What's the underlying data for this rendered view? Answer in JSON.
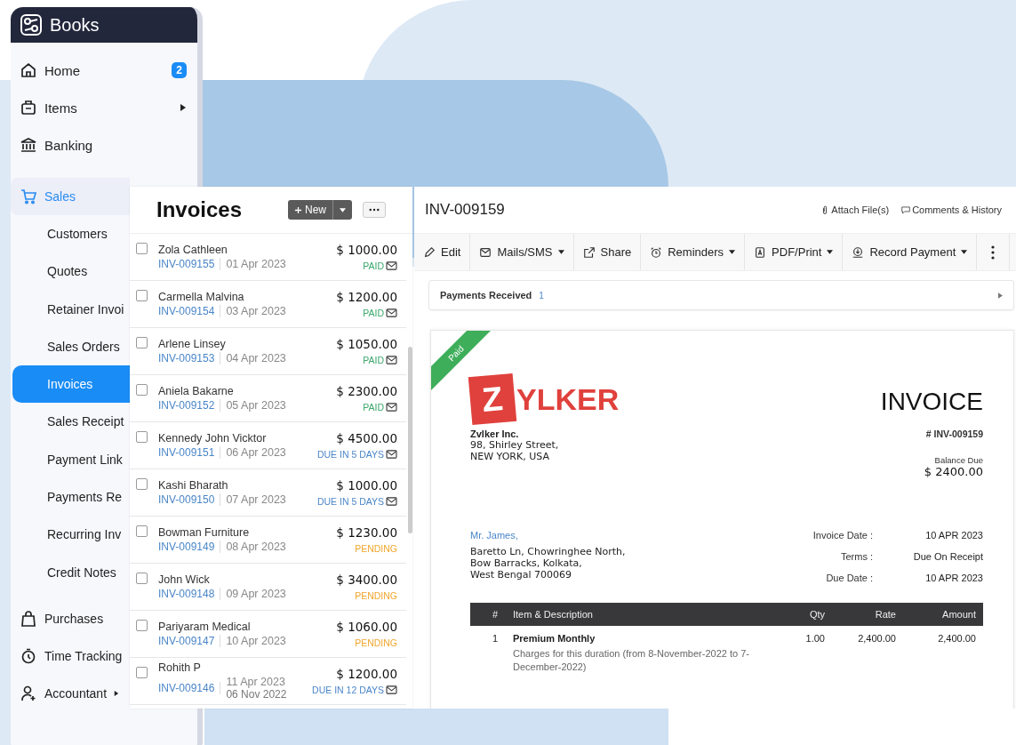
{
  "sidebar": {
    "brand": "Books",
    "items": [
      {
        "label": "Home",
        "badge": "2",
        "selected": false
      },
      {
        "label": "Items",
        "submenu": true,
        "selected": false
      },
      {
        "label": "Banking",
        "selected": false
      },
      {
        "label": "Sales",
        "selected": true,
        "children": [
          {
            "label": "Customers",
            "selected": false
          },
          {
            "label": "Quotes",
            "selected": false
          },
          {
            "label": "Retainer Invoi",
            "selected": false
          },
          {
            "label": "Sales Orders",
            "selected": false
          },
          {
            "label": "Invoices",
            "selected": true
          },
          {
            "label": "Sales Receipt",
            "selected": false
          },
          {
            "label": "Payment Link",
            "selected": false
          },
          {
            "label": "Payments Re",
            "selected": false
          },
          {
            "label": "Recurring Inv",
            "selected": false
          },
          {
            "label": "Credit Notes",
            "selected": false
          }
        ]
      },
      {
        "label": "Purchases",
        "selected": false
      },
      {
        "label": "Time Tracking",
        "selected": false
      },
      {
        "label": "Accountant",
        "submenu": true,
        "selected": false
      }
    ]
  },
  "invoice_list": {
    "title": "Invoices",
    "new_button": "New",
    "rows": [
      {
        "name": "Zola Cathleen",
        "number": "INV-009155",
        "date": "01 Apr 2023",
        "amount": "$ 1000.00",
        "status": "PAID",
        "kind": "paid",
        "emailed": true,
        "checked": false
      },
      {
        "name": "Carmella Malvina",
        "number": "INV-009154",
        "date": "03 Apr 2023",
        "amount": "$ 1200.00",
        "status": "PAID",
        "kind": "paid",
        "emailed": true,
        "checked": false
      },
      {
        "name": "Arlene Linsey",
        "number": "INV-009153",
        "date": "04 Apr 2023",
        "amount": "$ 1050.00",
        "status": "PAID",
        "kind": "paid",
        "emailed": true,
        "checked": false
      },
      {
        "name": "Aniela Bakarne",
        "number": "INV-009152",
        "date": "05 Apr 2023",
        "amount": "$ 2300.00",
        "status": "PAID",
        "kind": "paid",
        "emailed": true,
        "checked": false
      },
      {
        "name": "Kennedy John Vicktor",
        "number": "INV-009151",
        "date": "06 Apr 2023",
        "amount": "$ 4500.00",
        "status": "DUE IN 5 DAYS",
        "kind": "due",
        "emailed": true,
        "checked": false
      },
      {
        "name": "Kashi Bharath",
        "number": "INV-009150",
        "date": "07 Apr 2023",
        "amount": "$ 1000.00",
        "status": "DUE IN 5 DAYS",
        "kind": "due",
        "emailed": true,
        "checked": false
      },
      {
        "name": "Bowman Furniture",
        "number": "INV-009149",
        "date": "08 Apr 2023",
        "amount": "$ 1230.00",
        "status": "PENDING",
        "kind": "pending",
        "emailed": false,
        "checked": false
      },
      {
        "name": "John Wick",
        "number": "INV-009148",
        "date": "09 Apr 2023",
        "amount": "$ 3400.00",
        "status": "PENDING",
        "kind": "pending",
        "emailed": false,
        "checked": false
      },
      {
        "name": "Pariyaram Medical",
        "number": "INV-009147",
        "date": "10 Apr 2023",
        "amount": "$ 1060.00",
        "status": "PENDING",
        "kind": "pending",
        "emailed": false,
        "checked": false
      },
      {
        "name": "Rohith P",
        "number": "INV-009146",
        "date": "11 Apr 2023",
        "old_date": "06 Nov 2022",
        "amount": "$ 1200.00",
        "status": "DUE IN 12 DAYS",
        "kind": "due",
        "emailed": true,
        "checked": false
      }
    ]
  },
  "detail": {
    "title": "INV-009159",
    "attach": "Attach File(s)",
    "comments": "Comments & History",
    "toolbar": [
      {
        "label": "Edit",
        "dropdown": false
      },
      {
        "label": "Mails/SMS",
        "dropdown": true
      },
      {
        "label": "Share",
        "dropdown": false
      },
      {
        "label": "Reminders",
        "dropdown": true
      },
      {
        "label": "PDF/Print",
        "dropdown": true
      },
      {
        "label": "Record Payment",
        "dropdown": true
      }
    ],
    "payments": {
      "label": "Payments Received",
      "count": "1"
    },
    "document": {
      "ribbon": "Paid",
      "logo_letter": "Z",
      "logo_rest": "YLKER",
      "heading": "INVOICE",
      "number": "# INV-009159",
      "company": "Zvlker Inc.",
      "company_address": [
        "98, Shirley Street,",
        "NEW YORK, USA"
      ],
      "balance_label": "Balance Due",
      "balance": "$ 2400.00",
      "customer": "Mr. James,",
      "customer_address": [
        "Baretto Ln, Chowringhee North,",
        "Bow Barracks, Kolkata,",
        "West Bengal 700069"
      ],
      "fields": [
        {
          "label": "Invoice Date :",
          "value": "10 APR 2023"
        },
        {
          "label": "Terms :",
          "value": "Due On Receipt"
        },
        {
          "label": "Due Date :",
          "value": "10 APR 2023"
        }
      ],
      "columns": [
        "#",
        "Item & Description",
        "Qty",
        "Rate",
        "Amount"
      ],
      "lines": [
        {
          "index": "1",
          "item": "Premium Monthly",
          "description": "Charges for this duration (from 8-November-2022 to 7-December-2022)",
          "qty": "1.00",
          "rate": "2,400.00",
          "amount": "2,400.00"
        }
      ]
    }
  }
}
